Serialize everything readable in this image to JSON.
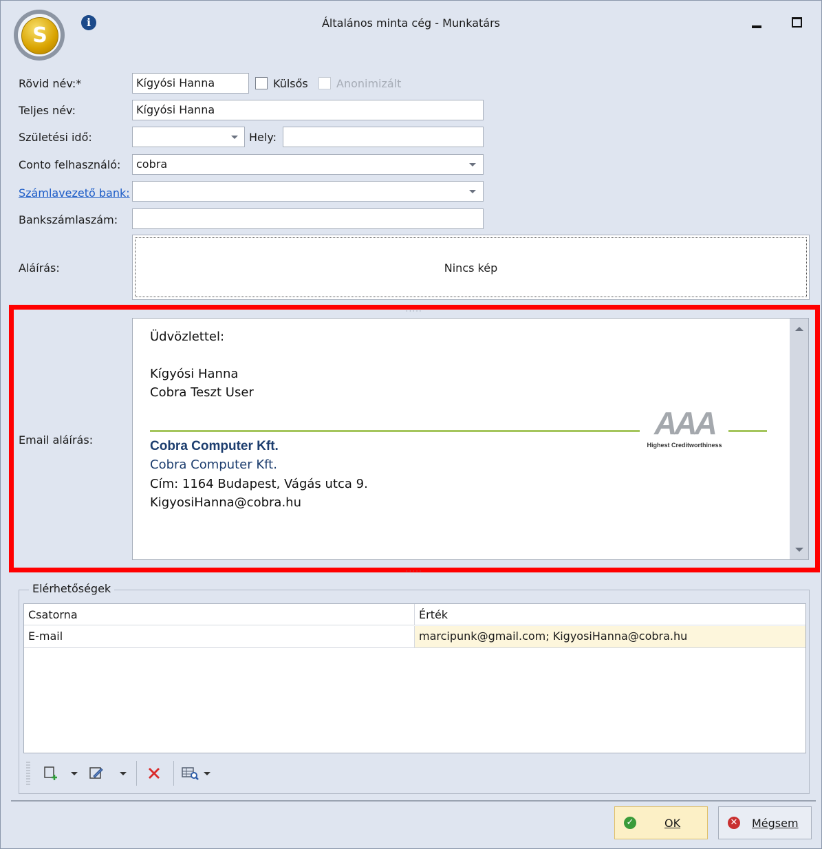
{
  "window": {
    "title": "Általános minta cég - Munkatárs",
    "logo_glyph": "S"
  },
  "form": {
    "short_name": {
      "label": "Rövid név:*",
      "value": "Kígyósi Hanna"
    },
    "external": {
      "label": "Külsős",
      "checked": false
    },
    "anonymized": {
      "label": "Anonimizált",
      "checked": false,
      "disabled": true
    },
    "full_name": {
      "label": "Teljes név:",
      "value": "Kígyósi Hanna"
    },
    "birth_date": {
      "label": "Születési idő:",
      "value": ""
    },
    "place": {
      "label": "Hely:",
      "value": ""
    },
    "conto_user": {
      "label": "Conto felhasználó:",
      "value": "cobra"
    },
    "bank": {
      "label": "Számlavezető bank:",
      "value": ""
    },
    "account_number": {
      "label": "Bankszámlaszám:",
      "value": ""
    },
    "signature": {
      "label": "Aláírás:",
      "placeholder": "Nincs kép"
    }
  },
  "email_signature": {
    "label": "Email aláírás:",
    "greeting": "Üdvözlettel:",
    "name": "Kígyósi Hanna",
    "position": "Cobra Teszt User",
    "company_bold": "Cobra Computer Kft.",
    "company": "Cobra Computer Kft.",
    "address": "Cím: 1164 Budapest, Vágás utca 9.",
    "email": "KigyosiHanna@cobra.hu",
    "badge_letters": "AAA",
    "badge_caption": "Highest Creditworthiness"
  },
  "contacts": {
    "group_title": "Elérhetőségek",
    "columns": [
      "Csatorna",
      "Érték"
    ],
    "rows": [
      {
        "channel": "E-mail",
        "value": "marcipunk@gmail.com; KigyosiHanna@cobra.hu"
      }
    ]
  },
  "buttons": {
    "ok": "OK",
    "cancel": "Mégsem"
  },
  "colors": {
    "highlight_frame": "#ff0000",
    "link": "#1b5bc7",
    "ok_bg": "#fcf0c6",
    "signature_rule": "#a4c55c",
    "company_blue": "#1c3d6e"
  }
}
